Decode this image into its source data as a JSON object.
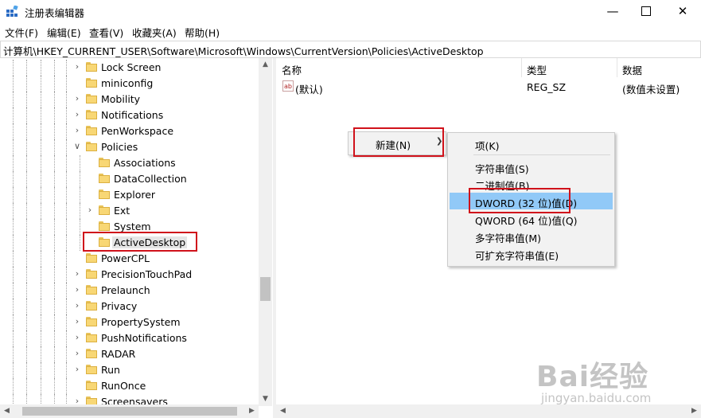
{
  "window": {
    "title": "注册表编辑器"
  },
  "menu": {
    "items": [
      "文件(F)",
      "编辑(E)",
      "查看(V)",
      "收藏夹(A)",
      "帮助(H)"
    ]
  },
  "address": {
    "path": "计算机\\HKEY_CURRENT_USER\\Software\\Microsoft\\Windows\\CurrentVersion\\Policies\\ActiveDesktop"
  },
  "tree": {
    "items": [
      {
        "label": "Lock Screen",
        "level": 1,
        "expander": "collapsed"
      },
      {
        "label": "miniconfig",
        "level": 1,
        "expander": "none"
      },
      {
        "label": "Mobility",
        "level": 1,
        "expander": "collapsed"
      },
      {
        "label": "Notifications",
        "level": 1,
        "expander": "collapsed"
      },
      {
        "label": "PenWorkspace",
        "level": 1,
        "expander": "collapsed"
      },
      {
        "label": "Policies",
        "level": 1,
        "expander": "expanded"
      },
      {
        "label": "Associations",
        "level": 2,
        "expander": "none"
      },
      {
        "label": "DataCollection",
        "level": 2,
        "expander": "none"
      },
      {
        "label": "Explorer",
        "level": 2,
        "expander": "none"
      },
      {
        "label": "Ext",
        "level": 2,
        "expander": "collapsed"
      },
      {
        "label": "System",
        "level": 2,
        "expander": "none"
      },
      {
        "label": "ActiveDesktop",
        "level": 2,
        "expander": "none",
        "selected": true
      },
      {
        "label": "PowerCPL",
        "level": 1,
        "expander": "none"
      },
      {
        "label": "PrecisionTouchPad",
        "level": 1,
        "expander": "collapsed"
      },
      {
        "label": "Prelaunch",
        "level": 1,
        "expander": "collapsed"
      },
      {
        "label": "Privacy",
        "level": 1,
        "expander": "collapsed"
      },
      {
        "label": "PropertySystem",
        "level": 1,
        "expander": "collapsed"
      },
      {
        "label": "PushNotifications",
        "level": 1,
        "expander": "collapsed"
      },
      {
        "label": "RADAR",
        "level": 1,
        "expander": "collapsed"
      },
      {
        "label": "Run",
        "level": 1,
        "expander": "collapsed"
      },
      {
        "label": "RunOnce",
        "level": 1,
        "expander": "none"
      },
      {
        "label": "Screensavers",
        "level": 1,
        "expander": "collapsed"
      }
    ]
  },
  "list": {
    "columns": {
      "name": "名称",
      "type": "类型",
      "data": "数据"
    },
    "rows": [
      {
        "icon": "ab",
        "name": "(默认)",
        "type": "REG_SZ",
        "data": "(数值未设置)"
      }
    ]
  },
  "context_menu": {
    "new_label": "新建(N)"
  },
  "submenu": {
    "items": [
      "项(K)",
      "字符串值(S)",
      "二进制值(B)",
      "DWORD (32 位)值(D)",
      "QWORD (64 位)值(Q)",
      "多字符串值(M)",
      "可扩充字符串值(E)"
    ],
    "highlighted": "DWORD (32 位)值(D)"
  },
  "watermark": {
    "logo": "Bai经验",
    "url": "jingyan.baidu.com"
  },
  "colors": {
    "highlight": "#91c9f7",
    "annotation_red": "#d0121b",
    "folder": "#f8d775"
  },
  "icons": {
    "app": "registry-editor-icon",
    "minimize": "minimize-icon",
    "maximize": "maximize-icon",
    "close": "close-icon",
    "folder": "folder-icon",
    "string_value": "string-value-icon",
    "submenu_arrow": "chevron-right-icon"
  }
}
